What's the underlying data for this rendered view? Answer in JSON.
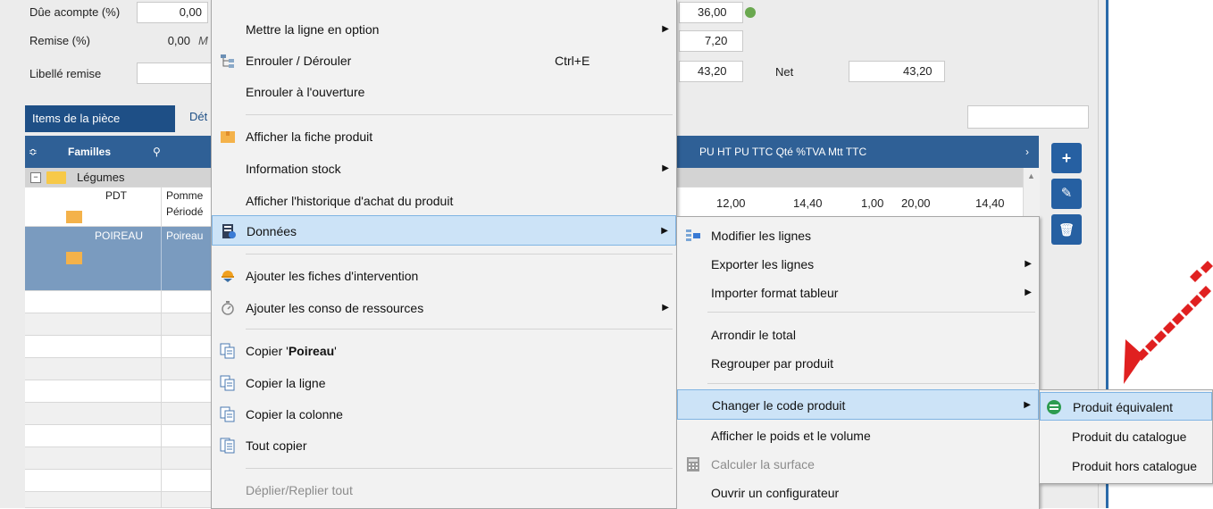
{
  "form": {
    "acompte_label": "Dûe acompte (%)",
    "acompte_value": "0,00",
    "remise_label": "Remise (%)",
    "remise_value": "0,00",
    "libelle_label": "Libellé remise",
    "m_label": "M",
    "total1": "36,00",
    "total2": "7,20",
    "total3": "43,20",
    "net_label": "Net",
    "net_value": "43,20"
  },
  "tabs": {
    "items": "Items de la pièce",
    "detail": "Dét"
  },
  "grid": {
    "headers": {
      "familles": "Familles",
      "right": "PU HT  PU TTC  Qté  %TVA  Mtt TTC"
    },
    "group": "Légumes",
    "rows": [
      {
        "code": "PDT",
        "desc": "Pomme",
        "desc2": "Périodé",
        "pu_ht": "12,00",
        "pu_ttc": "14,40",
        "qte": "1,00",
        "tva": "20,00",
        "mtt": "14,40"
      },
      {
        "code": "POIREAU",
        "desc": "Poireau"
      }
    ]
  },
  "menu": {
    "items": [
      {
        "label": "Mettre la ligne en option",
        "arrow": true
      },
      {
        "label": "Enrouler / Dérouler",
        "shortcut": "Ctrl+E"
      },
      {
        "label": "Enrouler à l'ouverture"
      },
      {
        "label": "Afficher la fiche produit"
      },
      {
        "label": "Information stock",
        "arrow": true
      },
      {
        "label": "Afficher l'historique d'achat du produit"
      },
      {
        "label": "Données",
        "arrow": true
      },
      {
        "label": "Ajouter les fiches d'intervention"
      },
      {
        "label": "Ajouter les conso de ressources",
        "arrow": true
      },
      {
        "label": "Copier 'Poireau'",
        "prefix": "Copier '",
        "bold": "Poireau",
        "suffix": "'"
      },
      {
        "label": "Copier la ligne"
      },
      {
        "label": "Copier la colonne"
      },
      {
        "label": "Tout copier"
      },
      {
        "label": "Déplier/Replier tout"
      }
    ]
  },
  "submenu": {
    "items": [
      {
        "label": "Modifier les lignes"
      },
      {
        "label": "Exporter les lignes",
        "arrow": true
      },
      {
        "label": "Importer format tableur",
        "arrow": true
      },
      {
        "label": "Arrondir le total"
      },
      {
        "label": "Regrouper par produit"
      },
      {
        "label": "Changer le code produit",
        "arrow": true
      },
      {
        "label": "Afficher le poids et le volume"
      },
      {
        "label": "Calculer la surface"
      },
      {
        "label": "Ouvrir un configurateur"
      }
    ]
  },
  "submenu2": {
    "items": [
      {
        "label": "Produit équivalent"
      },
      {
        "label": "Produit du catalogue"
      },
      {
        "label": "Produit hors catalogue"
      }
    ]
  },
  "colors": {
    "accent": "#2660a2",
    "annotation": "#e02020",
    "highlight": "#cce3f7"
  }
}
